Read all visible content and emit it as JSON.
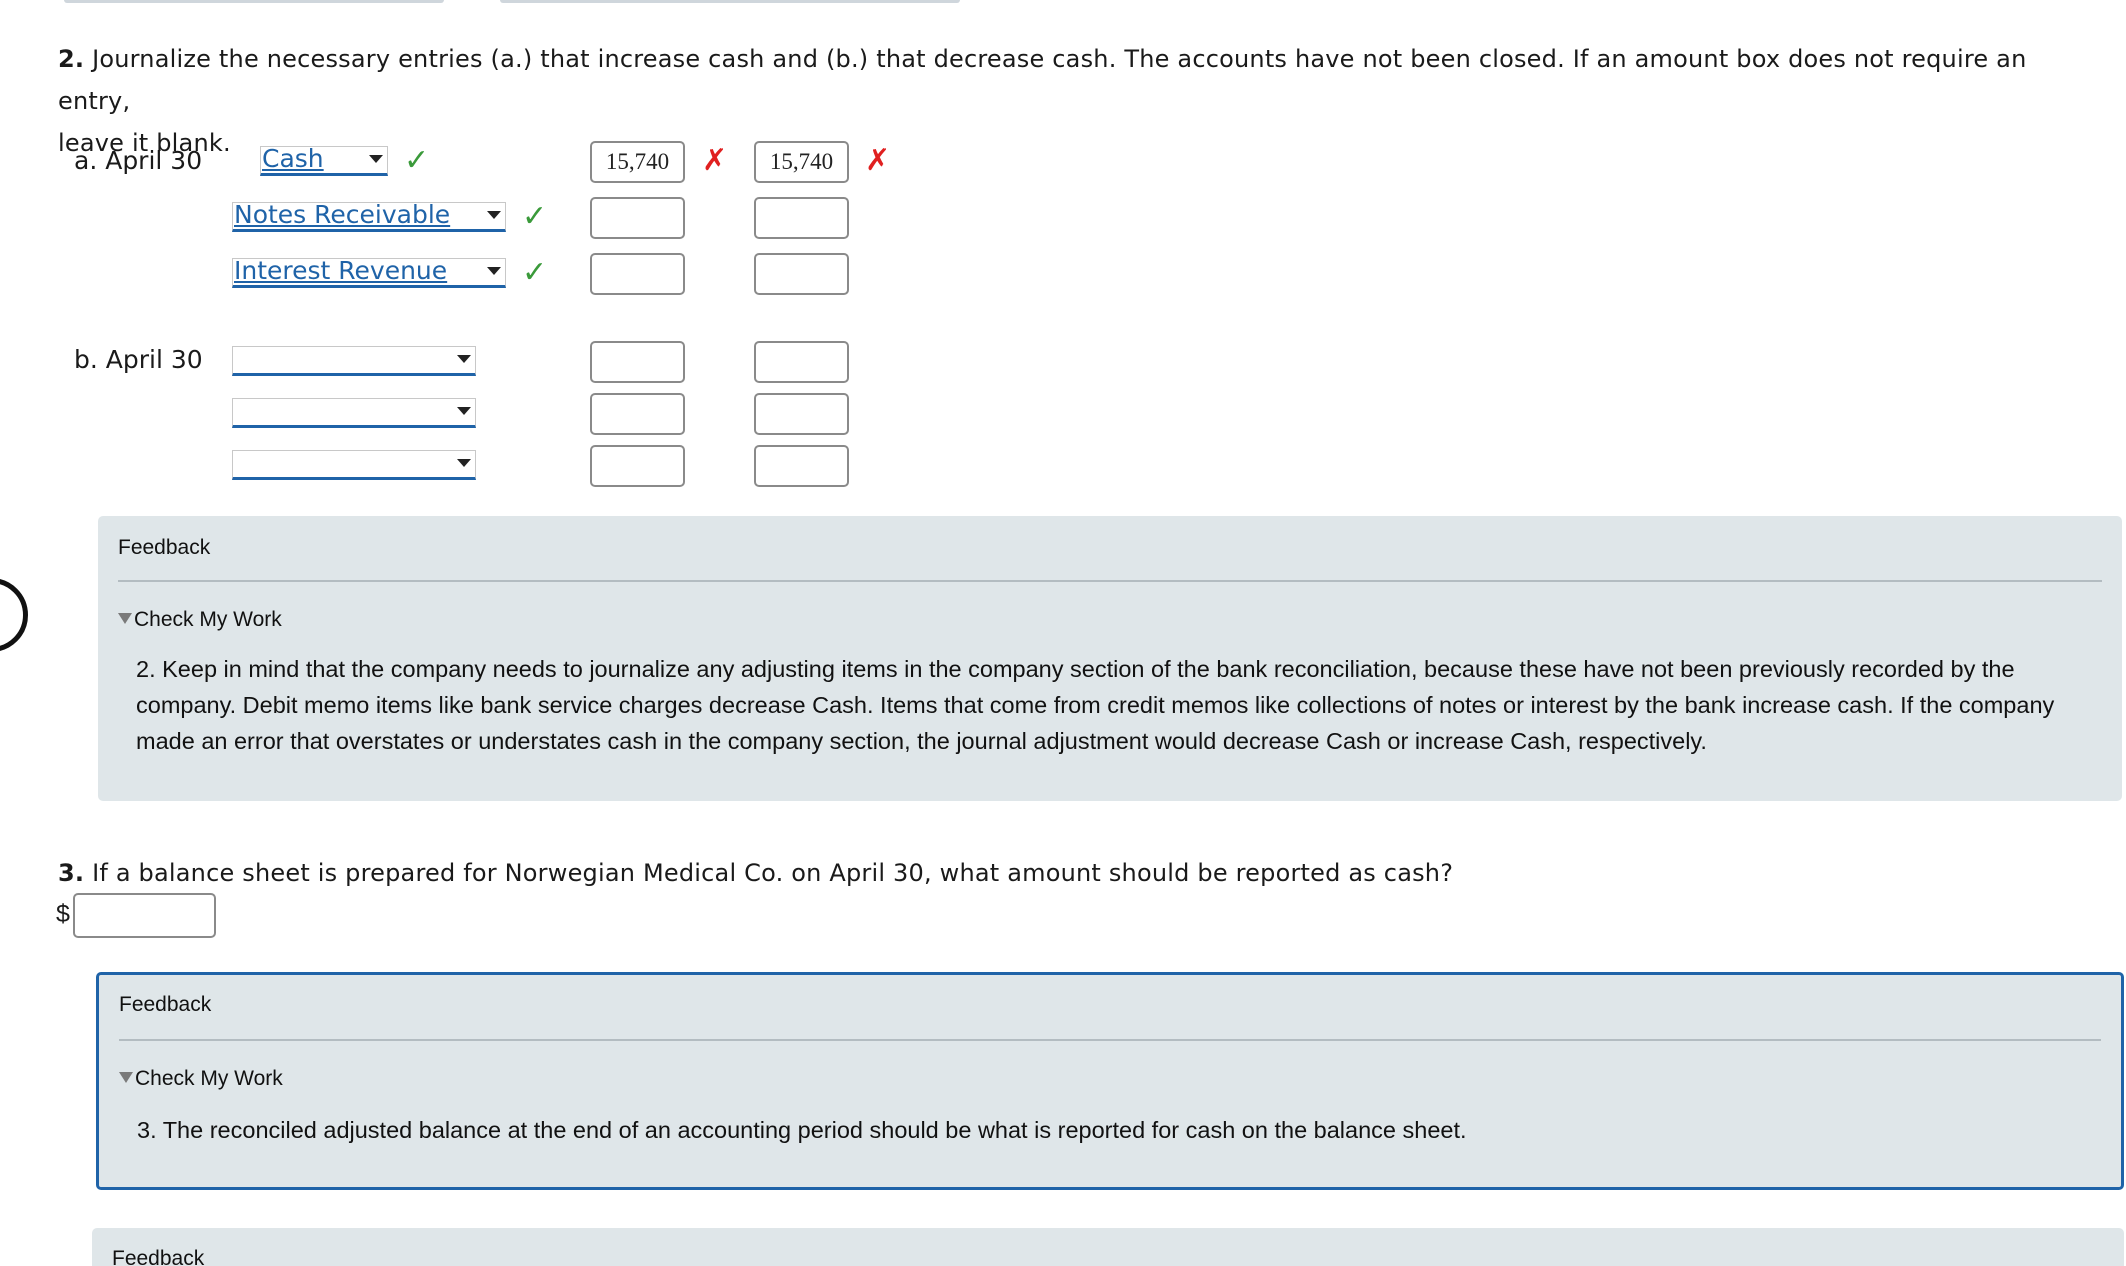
{
  "question2": {
    "number": "2.",
    "text_line1": "Journalize the necessary entries (a.) that increase cash and (b.) that decrease cash. The accounts have not been closed. If an amount box does not require an entry,",
    "text_line2": "leave it blank."
  },
  "entry_a": {
    "label": "a. April 30",
    "rows": [
      {
        "account": "Cash",
        "debit": "15,740",
        "credit": "15,740",
        "status": "correct"
      },
      {
        "account": "Notes Receivable",
        "debit": "",
        "credit": "",
        "status": "correct"
      },
      {
        "account": "Interest Revenue",
        "debit": "",
        "credit": "",
        "status": "correct"
      }
    ],
    "debit_status": "incorrect",
    "credit_status": "incorrect"
  },
  "entry_b": {
    "label": "b. April 30",
    "rows": [
      {
        "account": "",
        "debit": "",
        "credit": ""
      },
      {
        "account": "",
        "debit": "",
        "credit": ""
      },
      {
        "account": "",
        "debit": "",
        "credit": ""
      }
    ]
  },
  "feedback1": {
    "title": "Feedback",
    "check_label": "Check My Work",
    "body": "2. Keep in mind that the company needs to journalize any adjusting items in the company section of the bank reconciliation, because these have not been previously recorded by the company. Debit memo items like bank service charges decrease Cash. Items that come from credit memos like collections of notes or interest by the bank increase cash. If the company made an error that overstates or understates cash in the company section, the journal adjustment would decrease Cash or increase Cash, respectively."
  },
  "question3": {
    "number": "3.",
    "text": "If a balance sheet is prepared for Norwegian Medical Co. on April 30, what amount should be reported as cash?",
    "currency": "$",
    "value": ""
  },
  "feedback2": {
    "title": "Feedback",
    "check_label": "Check My Work",
    "body": "3. The reconciled adjusted balance at the end of an accounting period should be what is reported for cash on the balance sheet."
  },
  "feedback3": {
    "title": "Feedback"
  },
  "marks": {
    "check": "✓",
    "x": "✗"
  },
  "colors": {
    "link_blue": "#1f63a8",
    "correct_green": "#3a9a3a",
    "incorrect_red": "#e02020",
    "feedback_bg": "#dfe6e9"
  }
}
